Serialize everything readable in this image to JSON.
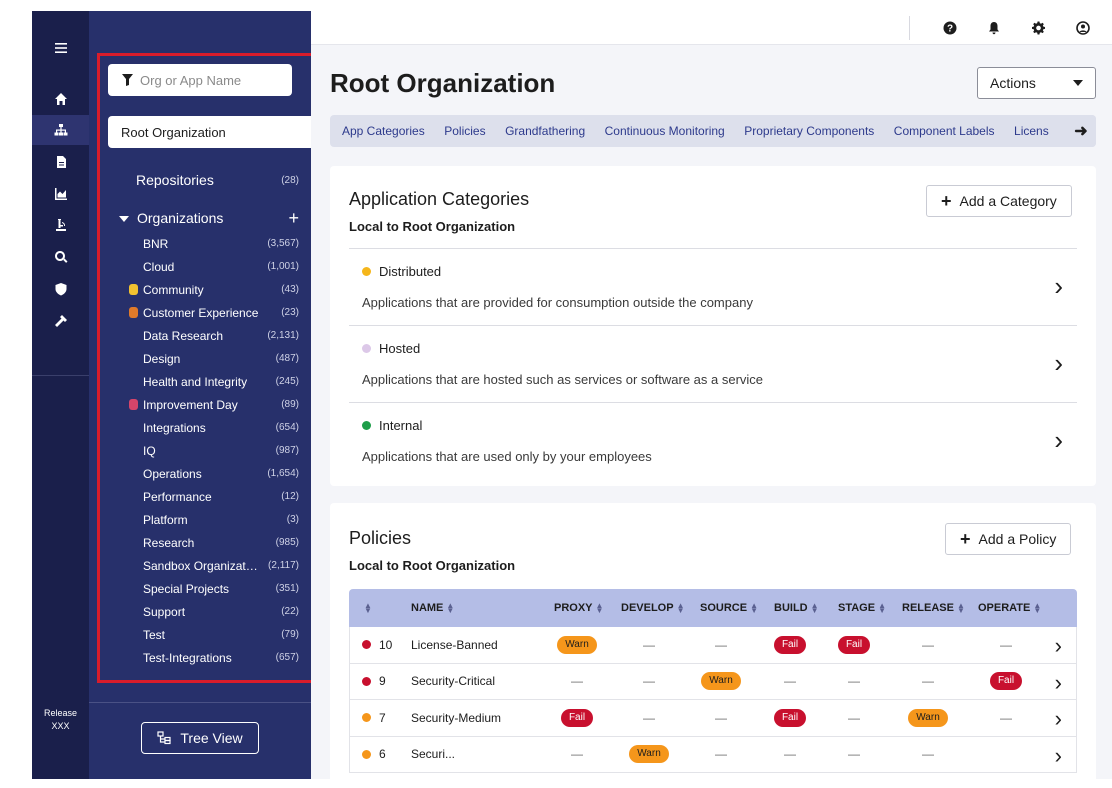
{
  "rail": {
    "release_line1": "Release",
    "release_line2": "XXX",
    "icons": [
      "menu-icon",
      "home-icon",
      "org-tree-icon",
      "document-icon",
      "chart-icon",
      "lab-icon",
      "search-icon",
      "shield-icon",
      "tools-icon"
    ]
  },
  "sidebar": {
    "filter_placeholder": "Org or App Name",
    "root_label": "Root Organization",
    "repositories_label": "Repositories",
    "repositories_count": "(28)",
    "organizations_label": "Organizations",
    "orgs": [
      {
        "name": "BNR",
        "count": "(3,567)",
        "emoji": ""
      },
      {
        "name": "Cloud",
        "count": "(1,001)",
        "emoji": ""
      },
      {
        "name": "Community",
        "count": "(43)",
        "emoji": "#f2c230"
      },
      {
        "name": "Customer Experience",
        "count": "(23)",
        "emoji": "#e07a2a"
      },
      {
        "name": "Data Research",
        "count": "(2,131)",
        "emoji": ""
      },
      {
        "name": "Design",
        "count": "(487)",
        "emoji": ""
      },
      {
        "name": "Health and Integrity",
        "count": "(245)",
        "emoji": ""
      },
      {
        "name": "Improvement Day",
        "count": "(89)",
        "emoji": "#d6456a"
      },
      {
        "name": "Integrations",
        "count": "(654)",
        "emoji": ""
      },
      {
        "name": "IQ",
        "count": "(987)",
        "emoji": ""
      },
      {
        "name": "Operations",
        "count": "(1,654)",
        "emoji": ""
      },
      {
        "name": "Performance",
        "count": "(12)",
        "emoji": ""
      },
      {
        "name": "Platform",
        "count": "(3)",
        "emoji": ""
      },
      {
        "name": "Research",
        "count": "(985)",
        "emoji": ""
      },
      {
        "name": "Sandbox Organizatio...",
        "count": "(2,117)",
        "emoji": ""
      },
      {
        "name": "Special Projects",
        "count": "(351)",
        "emoji": ""
      },
      {
        "name": "Support",
        "count": "(22)",
        "emoji": ""
      },
      {
        "name": "Test",
        "count": "(79)",
        "emoji": ""
      },
      {
        "name": "Test-Integrations",
        "count": "(657)",
        "emoji": ""
      }
    ],
    "tree_view_label": "Tree View"
  },
  "topbar": {
    "icons": [
      "help-icon",
      "bell-icon",
      "gear-icon",
      "user-icon"
    ]
  },
  "main": {
    "title": "Root Organization",
    "actions_label": "Actions",
    "tabs": [
      "App Categories",
      "Policies",
      "Grandfathering",
      "Continuous Monitoring",
      "Proprietary Components",
      "Component Labels",
      "Licens"
    ]
  },
  "categories_card": {
    "title": "Application Categories",
    "subtitle": "Local to Root Organization",
    "add_label": "Add a Category",
    "items": [
      {
        "name": "Distributed",
        "desc": "Applications that are provided for consumption outside the company",
        "color": "#f5b61b"
      },
      {
        "name": "Hosted",
        "desc": "Applications that are hosted such as services or software as a service",
        "color": "#dcc8e8"
      },
      {
        "name": "Internal",
        "desc": "Applications that are used only by your employees",
        "color": "#1e9e4a"
      }
    ]
  },
  "policies_card": {
    "title": "Policies",
    "subtitle": "Local to Root Organization",
    "add_label": "Add a Policy",
    "columns": [
      "NAME",
      "PROXY",
      "DEVELOP",
      "SOURCE",
      "BUILD",
      "STAGE",
      "RELEASE",
      "OPERATE"
    ],
    "rows": [
      {
        "level": "10",
        "color": "#c8102e",
        "name": "License-Banned",
        "cells": [
          "Warn",
          "—",
          "—",
          "Fail",
          "Fail",
          "—",
          "—"
        ]
      },
      {
        "level": "9",
        "color": "#c8102e",
        "name": "Security-Critical",
        "cells": [
          "—",
          "—",
          "Warn",
          "—",
          "—",
          "—",
          "Fail"
        ]
      },
      {
        "level": "7",
        "color": "#f5961b",
        "name": "Security-Medium",
        "cells": [
          "Fail",
          "—",
          "—",
          "Fail",
          "—",
          "Warn",
          "—"
        ]
      },
      {
        "level": "6",
        "color": "#f5961b",
        "name": "Securi...",
        "cells": [
          "—",
          "Warn",
          "—",
          "—",
          "—",
          "—",
          ""
        ]
      }
    ]
  }
}
